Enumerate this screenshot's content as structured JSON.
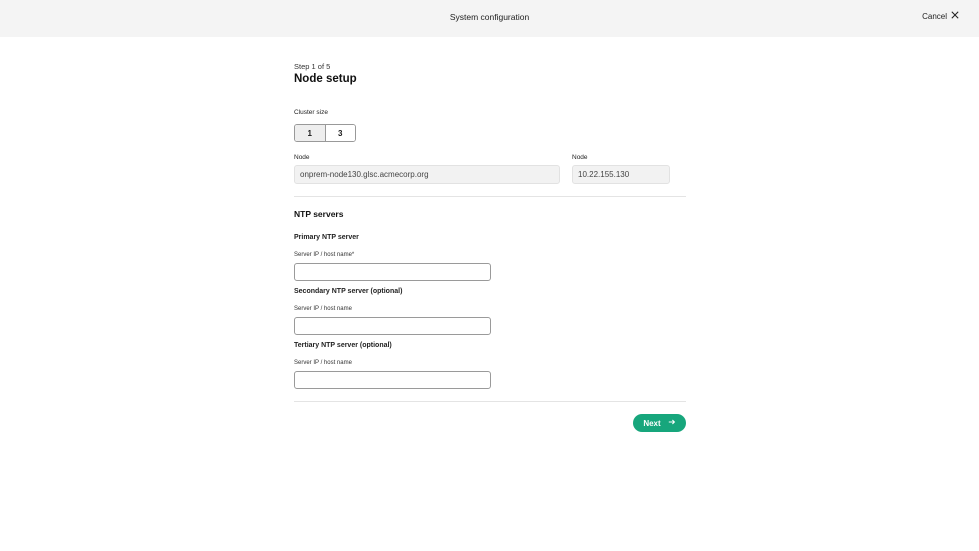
{
  "header": {
    "title": "System configuration",
    "cancel_label": "Cancel",
    "cancel_icon": "close-icon"
  },
  "wizard": {
    "step": "Step 1 of 5",
    "title": "Node setup"
  },
  "cluster": {
    "label": "Cluster size",
    "options": [
      "1",
      "3"
    ],
    "selected": "1"
  },
  "nodes": [
    {
      "label": "Node",
      "value": "onprem-node130.glsc.acmecorp.org"
    },
    {
      "label": "Node",
      "value": "10.22.155.130"
    }
  ],
  "ntp": {
    "heading": "NTP servers",
    "primary": {
      "heading": "Primary NTP server",
      "label": "Server IP / host name*",
      "value": ""
    },
    "secondary": {
      "heading": "Secondary NTP server (optional)",
      "label": "Server IP / host name",
      "value": ""
    },
    "tertiary": {
      "heading": "Tertiary NTP server (optional)",
      "label": "Server IP / host name",
      "value": ""
    }
  },
  "footer": {
    "next_label": "Next",
    "next_icon": "arrow-right-icon"
  },
  "colors": {
    "accent": "#17a67c",
    "topbar": "#f4f4f4"
  }
}
